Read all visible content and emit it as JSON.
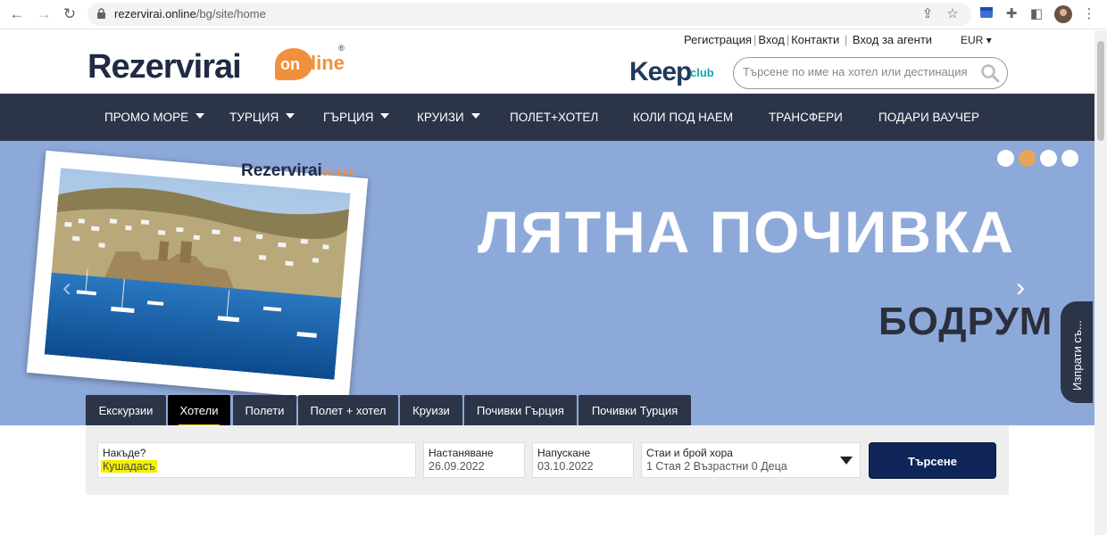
{
  "browser": {
    "url_host": "rezervirai.online",
    "url_path": "/bg/site/home"
  },
  "header": {
    "logo_main": "Rezervirai",
    "logo_on": "on",
    "logo_line": "line",
    "logo_reg": "®",
    "top_links": [
      "Регистрация",
      "Вход",
      "Контакти",
      "Вход за агенти"
    ],
    "currency": "EUR",
    "keep_word": "Keep",
    "keep_club": "club",
    "search_placeholder": "Търсене по име на хотел или дестинация"
  },
  "nav": {
    "items": [
      {
        "label": "ПРОМО МОРЕ",
        "dropdown": true
      },
      {
        "label": "ТУРЦИЯ",
        "dropdown": true
      },
      {
        "label": "ГЪРЦИЯ",
        "dropdown": true
      },
      {
        "label": "КРУИЗИ",
        "dropdown": true
      },
      {
        "label": "ПОЛЕТ+ХОТЕЛ",
        "dropdown": false
      },
      {
        "label": "КОЛИ ПОД НАЕМ",
        "dropdown": false
      },
      {
        "label": "ТРАНСФЕРИ",
        "dropdown": false
      },
      {
        "label": "ПОДАРИ ВАУЧЕР",
        "dropdown": false
      }
    ]
  },
  "hero": {
    "logo_main": "Rezervirai",
    "logo_badge": "on line",
    "title": "ЛЯТНА ПОЧИВКА",
    "subtitle": "БОДРУМ",
    "slide_count": 4,
    "active_slide": 2,
    "feedback_label": "Изпрати съ..."
  },
  "tabs": [
    {
      "label": "Екскурзии",
      "active": false
    },
    {
      "label": "Хотели",
      "active": true
    },
    {
      "label": "Полети",
      "active": false
    },
    {
      "label": "Полет + хотел",
      "active": false
    },
    {
      "label": "Круизи",
      "active": false
    },
    {
      "label": "Почивки Гърция",
      "active": false
    },
    {
      "label": "Почивки Турция",
      "active": false
    }
  ],
  "search_form": {
    "where_label": "Накъде?",
    "where_value": "Кушадасъ",
    "checkin_label": "Настаняване",
    "checkin_value": "26.09.2022",
    "checkout_label": "Напускане",
    "checkout_value": "03.10.2022",
    "rooms_label": "Стаи и брой хора",
    "rooms_value": "1 Стая 2 Възрастни 0 Деца",
    "submit_label": "Търсене"
  },
  "colors": {
    "nav_bg": "#2c3547",
    "hero_bg": "#8da9d9",
    "accent_orange": "#f0903c",
    "button_navy": "#0f2558",
    "highlight": "#f5f000"
  }
}
